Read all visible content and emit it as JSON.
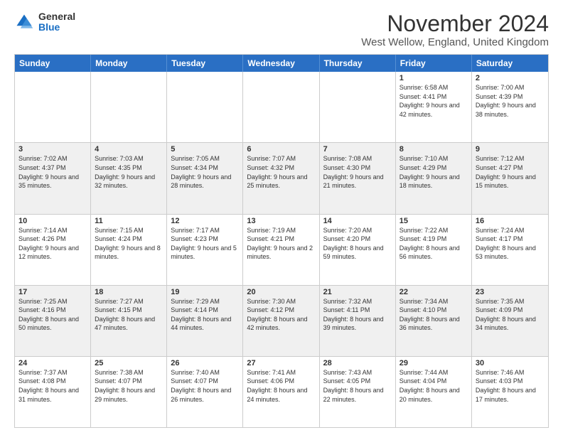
{
  "logo": {
    "general": "General",
    "blue": "Blue"
  },
  "title": "November 2024",
  "location": "West Wellow, England, United Kingdom",
  "days": [
    "Sunday",
    "Monday",
    "Tuesday",
    "Wednesday",
    "Thursday",
    "Friday",
    "Saturday"
  ],
  "rows": [
    [
      {
        "day": "",
        "info": ""
      },
      {
        "day": "",
        "info": ""
      },
      {
        "day": "",
        "info": ""
      },
      {
        "day": "",
        "info": ""
      },
      {
        "day": "",
        "info": ""
      },
      {
        "day": "1",
        "info": "Sunrise: 6:58 AM\nSunset: 4:41 PM\nDaylight: 9 hours and 42 minutes."
      },
      {
        "day": "2",
        "info": "Sunrise: 7:00 AM\nSunset: 4:39 PM\nDaylight: 9 hours and 38 minutes."
      }
    ],
    [
      {
        "day": "3",
        "info": "Sunrise: 7:02 AM\nSunset: 4:37 PM\nDaylight: 9 hours and 35 minutes."
      },
      {
        "day": "4",
        "info": "Sunrise: 7:03 AM\nSunset: 4:35 PM\nDaylight: 9 hours and 32 minutes."
      },
      {
        "day": "5",
        "info": "Sunrise: 7:05 AM\nSunset: 4:34 PM\nDaylight: 9 hours and 28 minutes."
      },
      {
        "day": "6",
        "info": "Sunrise: 7:07 AM\nSunset: 4:32 PM\nDaylight: 9 hours and 25 minutes."
      },
      {
        "day": "7",
        "info": "Sunrise: 7:08 AM\nSunset: 4:30 PM\nDaylight: 9 hours and 21 minutes."
      },
      {
        "day": "8",
        "info": "Sunrise: 7:10 AM\nSunset: 4:29 PM\nDaylight: 9 hours and 18 minutes."
      },
      {
        "day": "9",
        "info": "Sunrise: 7:12 AM\nSunset: 4:27 PM\nDaylight: 9 hours and 15 minutes."
      }
    ],
    [
      {
        "day": "10",
        "info": "Sunrise: 7:14 AM\nSunset: 4:26 PM\nDaylight: 9 hours and 12 minutes."
      },
      {
        "day": "11",
        "info": "Sunrise: 7:15 AM\nSunset: 4:24 PM\nDaylight: 9 hours and 8 minutes."
      },
      {
        "day": "12",
        "info": "Sunrise: 7:17 AM\nSunset: 4:23 PM\nDaylight: 9 hours and 5 minutes."
      },
      {
        "day": "13",
        "info": "Sunrise: 7:19 AM\nSunset: 4:21 PM\nDaylight: 9 hours and 2 minutes."
      },
      {
        "day": "14",
        "info": "Sunrise: 7:20 AM\nSunset: 4:20 PM\nDaylight: 8 hours and 59 minutes."
      },
      {
        "day": "15",
        "info": "Sunrise: 7:22 AM\nSunset: 4:19 PM\nDaylight: 8 hours and 56 minutes."
      },
      {
        "day": "16",
        "info": "Sunrise: 7:24 AM\nSunset: 4:17 PM\nDaylight: 8 hours and 53 minutes."
      }
    ],
    [
      {
        "day": "17",
        "info": "Sunrise: 7:25 AM\nSunset: 4:16 PM\nDaylight: 8 hours and 50 minutes."
      },
      {
        "day": "18",
        "info": "Sunrise: 7:27 AM\nSunset: 4:15 PM\nDaylight: 8 hours and 47 minutes."
      },
      {
        "day": "19",
        "info": "Sunrise: 7:29 AM\nSunset: 4:14 PM\nDaylight: 8 hours and 44 minutes."
      },
      {
        "day": "20",
        "info": "Sunrise: 7:30 AM\nSunset: 4:12 PM\nDaylight: 8 hours and 42 minutes."
      },
      {
        "day": "21",
        "info": "Sunrise: 7:32 AM\nSunset: 4:11 PM\nDaylight: 8 hours and 39 minutes."
      },
      {
        "day": "22",
        "info": "Sunrise: 7:34 AM\nSunset: 4:10 PM\nDaylight: 8 hours and 36 minutes."
      },
      {
        "day": "23",
        "info": "Sunrise: 7:35 AM\nSunset: 4:09 PM\nDaylight: 8 hours and 34 minutes."
      }
    ],
    [
      {
        "day": "24",
        "info": "Sunrise: 7:37 AM\nSunset: 4:08 PM\nDaylight: 8 hours and 31 minutes."
      },
      {
        "day": "25",
        "info": "Sunrise: 7:38 AM\nSunset: 4:07 PM\nDaylight: 8 hours and 29 minutes."
      },
      {
        "day": "26",
        "info": "Sunrise: 7:40 AM\nSunset: 4:07 PM\nDaylight: 8 hours and 26 minutes."
      },
      {
        "day": "27",
        "info": "Sunrise: 7:41 AM\nSunset: 4:06 PM\nDaylight: 8 hours and 24 minutes."
      },
      {
        "day": "28",
        "info": "Sunrise: 7:43 AM\nSunset: 4:05 PM\nDaylight: 8 hours and 22 minutes."
      },
      {
        "day": "29",
        "info": "Sunrise: 7:44 AM\nSunset: 4:04 PM\nDaylight: 8 hours and 20 minutes."
      },
      {
        "day": "30",
        "info": "Sunrise: 7:46 AM\nSunset: 4:03 PM\nDaylight: 8 hours and 17 minutes."
      }
    ]
  ]
}
